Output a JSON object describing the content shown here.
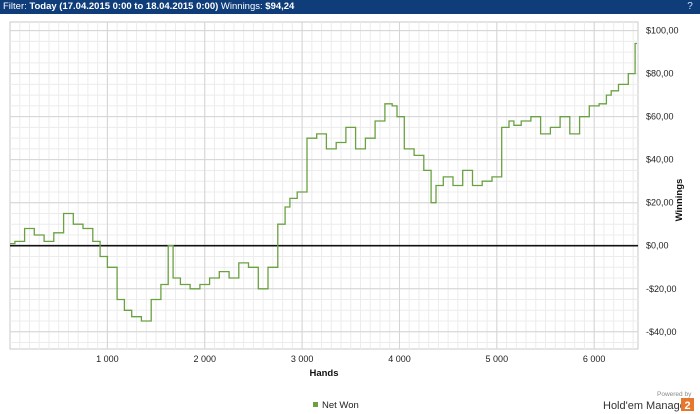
{
  "filter_bar": {
    "prefix": "Filter: ",
    "range": "Today (17.04.2015 0:00 to 18.04.2015 0:00)",
    "winnings_label": " Winnings: ",
    "winnings_value": "$94,24",
    "help_icon": "help-icon"
  },
  "branding": {
    "powered_by": "Powered by",
    "product": "Hold'em Manager",
    "logo_glyph": "2",
    "logo_color": "#e8772e"
  },
  "chart_data": {
    "type": "line",
    "title": "",
    "xlabel": "Hands",
    "ylabel": "Winnings",
    "xlim": [
      0,
      6450
    ],
    "ylim": [
      -48,
      104
    ],
    "x_ticks": [
      1000,
      2000,
      3000,
      4000,
      5000,
      6000
    ],
    "x_tick_labels": [
      "1 000",
      "2 000",
      "3 000",
      "4 000",
      "5 000",
      "6 000"
    ],
    "y_ticks": [
      -40,
      -20,
      0,
      20,
      40,
      60,
      80,
      100
    ],
    "y_tick_labels": [
      "-$40,00",
      "-$20,00",
      "$0,00",
      "$20,00",
      "$40,00",
      "$60,00",
      "$80,00",
      "$100,00"
    ],
    "grid": true,
    "zero_line": true,
    "legend_position": "bottom",
    "series": [
      {
        "name": "Net Won",
        "color": "#6aa142",
        "x": [
          0,
          100,
          200,
          300,
          400,
          500,
          600,
          700,
          800,
          900,
          950,
          1050,
          1150,
          1200,
          1300,
          1400,
          1500,
          1600,
          1650,
          1700,
          1800,
          1900,
          2000,
          2100,
          2200,
          2300,
          2400,
          2500,
          2600,
          2700,
          2800,
          2850,
          2900,
          3000,
          3100,
          3200,
          3300,
          3400,
          3500,
          3600,
          3700,
          3800,
          3900,
          3950,
          4000,
          4100,
          4200,
          4300,
          4350,
          4400,
          4500,
          4600,
          4700,
          4800,
          4900,
          5000,
          5100,
          5150,
          5200,
          5300,
          5400,
          5500,
          5600,
          5700,
          5800,
          5900,
          6000,
          6100,
          6150,
          6200,
          6300,
          6400,
          6440
        ],
        "values": [
          1,
          2,
          8,
          5,
          2,
          6,
          15,
          10,
          8,
          2,
          -5,
          -10,
          -25,
          -30,
          -33,
          -35,
          -25,
          -18,
          0,
          -15,
          -18,
          -20,
          -18,
          -15,
          -12,
          -15,
          -8,
          -10,
          -20,
          -10,
          10,
          18,
          22,
          25,
          50,
          52,
          45,
          48,
          55,
          45,
          50,
          58,
          66,
          65,
          60,
          45,
          42,
          35,
          20,
          28,
          32,
          28,
          35,
          28,
          30,
          32,
          55,
          58,
          56,
          58,
          60,
          52,
          55,
          60,
          52,
          60,
          65,
          66,
          70,
          72,
          75,
          80,
          94
        ]
      }
    ]
  }
}
